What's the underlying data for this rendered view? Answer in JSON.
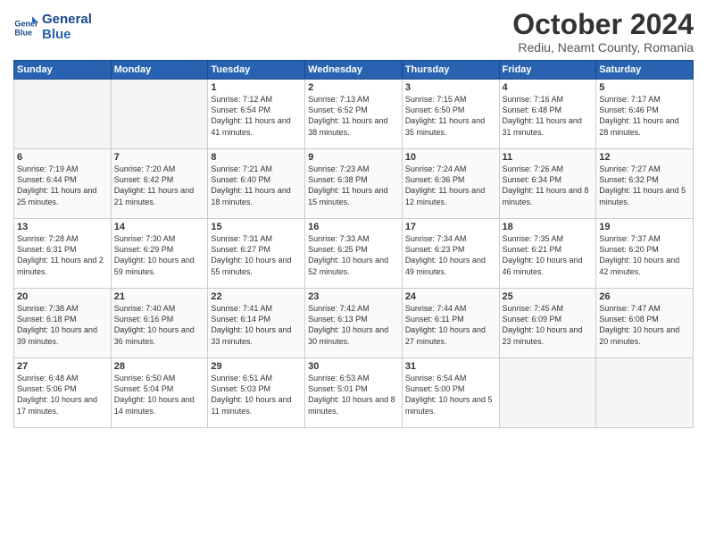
{
  "header": {
    "logo_line1": "General",
    "logo_line2": "Blue",
    "title": "October 2024",
    "subtitle": "Rediu, Neamt County, Romania"
  },
  "weekdays": [
    "Sunday",
    "Monday",
    "Tuesday",
    "Wednesday",
    "Thursday",
    "Friday",
    "Saturday"
  ],
  "weeks": [
    [
      {
        "day": "",
        "info": ""
      },
      {
        "day": "",
        "info": ""
      },
      {
        "day": "1",
        "info": "Sunrise: 7:12 AM\nSunset: 6:54 PM\nDaylight: 11 hours and 41 minutes."
      },
      {
        "day": "2",
        "info": "Sunrise: 7:13 AM\nSunset: 6:52 PM\nDaylight: 11 hours and 38 minutes."
      },
      {
        "day": "3",
        "info": "Sunrise: 7:15 AM\nSunset: 6:50 PM\nDaylight: 11 hours and 35 minutes."
      },
      {
        "day": "4",
        "info": "Sunrise: 7:16 AM\nSunset: 6:48 PM\nDaylight: 11 hours and 31 minutes."
      },
      {
        "day": "5",
        "info": "Sunrise: 7:17 AM\nSunset: 6:46 PM\nDaylight: 11 hours and 28 minutes."
      }
    ],
    [
      {
        "day": "6",
        "info": "Sunrise: 7:19 AM\nSunset: 6:44 PM\nDaylight: 11 hours and 25 minutes."
      },
      {
        "day": "7",
        "info": "Sunrise: 7:20 AM\nSunset: 6:42 PM\nDaylight: 11 hours and 21 minutes."
      },
      {
        "day": "8",
        "info": "Sunrise: 7:21 AM\nSunset: 6:40 PM\nDaylight: 11 hours and 18 minutes."
      },
      {
        "day": "9",
        "info": "Sunrise: 7:23 AM\nSunset: 6:38 PM\nDaylight: 11 hours and 15 minutes."
      },
      {
        "day": "10",
        "info": "Sunrise: 7:24 AM\nSunset: 6:36 PM\nDaylight: 11 hours and 12 minutes."
      },
      {
        "day": "11",
        "info": "Sunrise: 7:26 AM\nSunset: 6:34 PM\nDaylight: 11 hours and 8 minutes."
      },
      {
        "day": "12",
        "info": "Sunrise: 7:27 AM\nSunset: 6:32 PM\nDaylight: 11 hours and 5 minutes."
      }
    ],
    [
      {
        "day": "13",
        "info": "Sunrise: 7:28 AM\nSunset: 6:31 PM\nDaylight: 11 hours and 2 minutes."
      },
      {
        "day": "14",
        "info": "Sunrise: 7:30 AM\nSunset: 6:29 PM\nDaylight: 10 hours and 59 minutes."
      },
      {
        "day": "15",
        "info": "Sunrise: 7:31 AM\nSunset: 6:27 PM\nDaylight: 10 hours and 55 minutes."
      },
      {
        "day": "16",
        "info": "Sunrise: 7:33 AM\nSunset: 6:25 PM\nDaylight: 10 hours and 52 minutes."
      },
      {
        "day": "17",
        "info": "Sunrise: 7:34 AM\nSunset: 6:23 PM\nDaylight: 10 hours and 49 minutes."
      },
      {
        "day": "18",
        "info": "Sunrise: 7:35 AM\nSunset: 6:21 PM\nDaylight: 10 hours and 46 minutes."
      },
      {
        "day": "19",
        "info": "Sunrise: 7:37 AM\nSunset: 6:20 PM\nDaylight: 10 hours and 42 minutes."
      }
    ],
    [
      {
        "day": "20",
        "info": "Sunrise: 7:38 AM\nSunset: 6:18 PM\nDaylight: 10 hours and 39 minutes."
      },
      {
        "day": "21",
        "info": "Sunrise: 7:40 AM\nSunset: 6:16 PM\nDaylight: 10 hours and 36 minutes."
      },
      {
        "day": "22",
        "info": "Sunrise: 7:41 AM\nSunset: 6:14 PM\nDaylight: 10 hours and 33 minutes."
      },
      {
        "day": "23",
        "info": "Sunrise: 7:42 AM\nSunset: 6:13 PM\nDaylight: 10 hours and 30 minutes."
      },
      {
        "day": "24",
        "info": "Sunrise: 7:44 AM\nSunset: 6:11 PM\nDaylight: 10 hours and 27 minutes."
      },
      {
        "day": "25",
        "info": "Sunrise: 7:45 AM\nSunset: 6:09 PM\nDaylight: 10 hours and 23 minutes."
      },
      {
        "day": "26",
        "info": "Sunrise: 7:47 AM\nSunset: 6:08 PM\nDaylight: 10 hours and 20 minutes."
      }
    ],
    [
      {
        "day": "27",
        "info": "Sunrise: 6:48 AM\nSunset: 5:06 PM\nDaylight: 10 hours and 17 minutes."
      },
      {
        "day": "28",
        "info": "Sunrise: 6:50 AM\nSunset: 5:04 PM\nDaylight: 10 hours and 14 minutes."
      },
      {
        "day": "29",
        "info": "Sunrise: 6:51 AM\nSunset: 5:03 PM\nDaylight: 10 hours and 11 minutes."
      },
      {
        "day": "30",
        "info": "Sunrise: 6:53 AM\nSunset: 5:01 PM\nDaylight: 10 hours and 8 minutes."
      },
      {
        "day": "31",
        "info": "Sunrise: 6:54 AM\nSunset: 5:00 PM\nDaylight: 10 hours and 5 minutes."
      },
      {
        "day": "",
        "info": ""
      },
      {
        "day": "",
        "info": ""
      }
    ]
  ]
}
